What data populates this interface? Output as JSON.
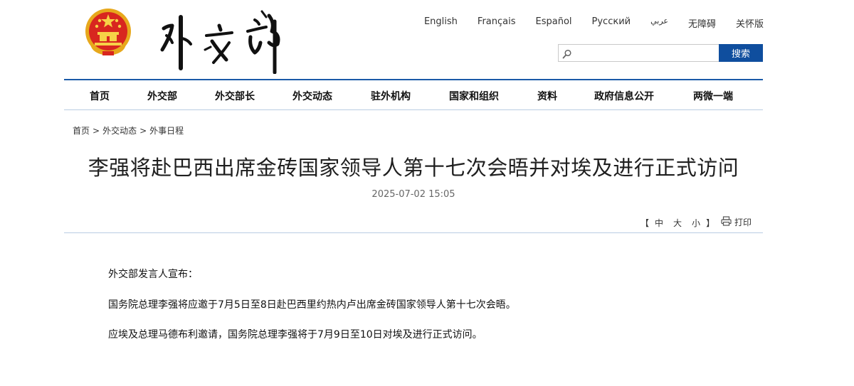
{
  "languages": [
    "English",
    "Français",
    "Español",
    "Русский",
    "عربي",
    "无障碍",
    "关怀版"
  ],
  "search": {
    "placeholder": "",
    "button_label": "搜索"
  },
  "nav": {
    "items": [
      "首页",
      "外交部",
      "外交部长",
      "外交动态",
      "驻外机构",
      "国家和组织",
      "资料",
      "政府信息公开",
      "两微一端"
    ]
  },
  "breadcrumb": {
    "items": [
      "首页",
      "外交动态",
      "外事日程"
    ],
    "separator": ">"
  },
  "article": {
    "title": "李强将赴巴西出席金砖国家领导人第十七次会晤并对埃及进行正式访问",
    "date": "2025-07-02 15:05",
    "font_size": {
      "open": "【",
      "medium": "中",
      "large": "大",
      "small": "小",
      "close": "】"
    },
    "print_label": "打印",
    "paragraphs": [
      "外交部发言人宣布：",
      "国务院总理李强将应邀于7月5日至8日赴巴西里约热内卢出席金砖国家领导人第十七次会晤。",
      "应埃及总理马德布利邀请，国务院总理李强将于7月9日至10日对埃及进行正式访问。"
    ]
  },
  "icons": {
    "search": "search-icon",
    "print": "printer-icon",
    "emblem": "national-emblem-icon"
  },
  "colors": {
    "accent_blue": "#0f4e9e",
    "nav_line": "#1a5aa8",
    "emblem_red": "#d8261f",
    "emblem_gold": "#f3c12b"
  }
}
